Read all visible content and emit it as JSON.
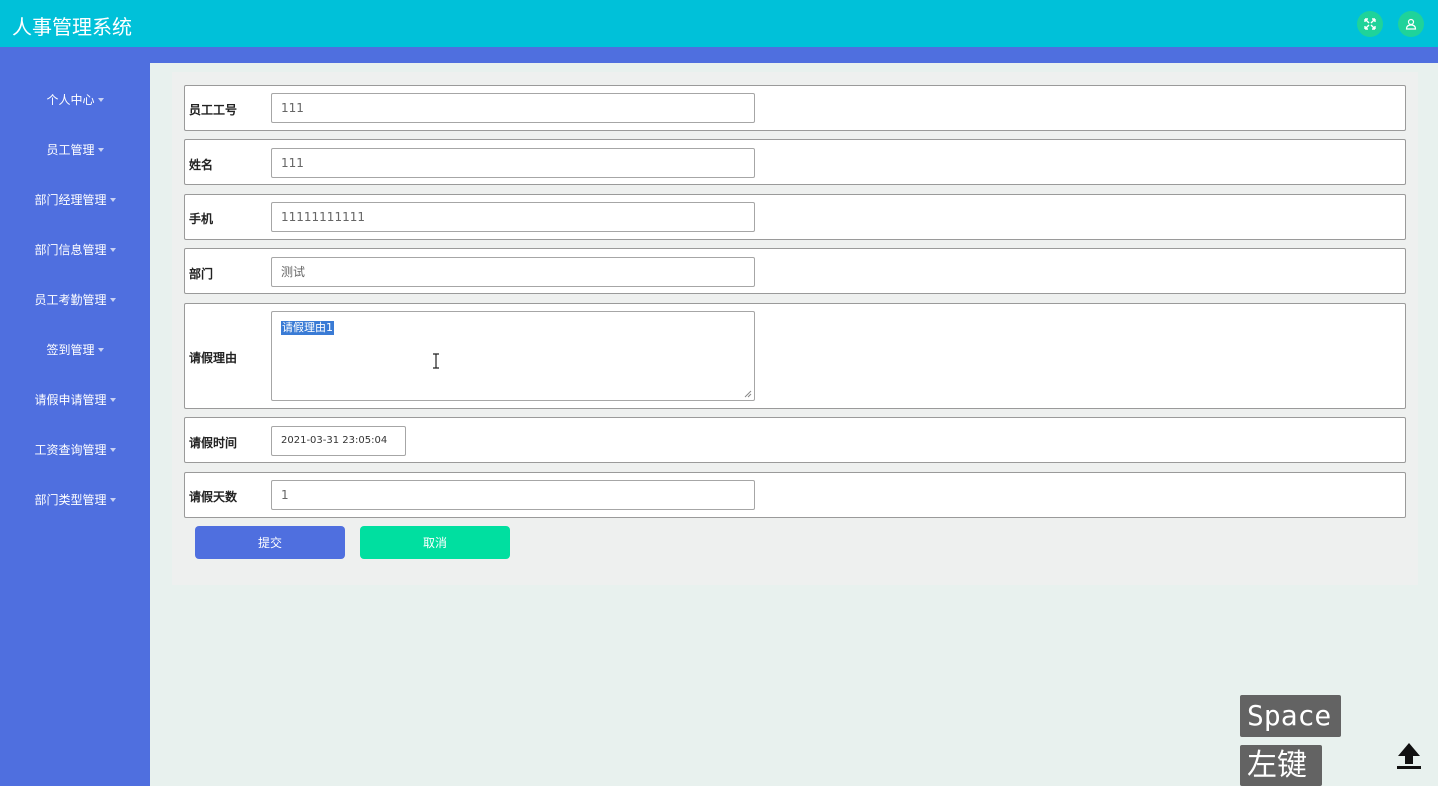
{
  "app": {
    "title": "人事管理系统"
  },
  "header": {
    "fullscreen_icon": "expand-icon",
    "user_icon": "user-icon"
  },
  "sidebar": {
    "items": [
      {
        "label": "个人中心"
      },
      {
        "label": "员工管理"
      },
      {
        "label": "部门经理管理"
      },
      {
        "label": "部门信息管理"
      },
      {
        "label": "员工考勤管理"
      },
      {
        "label": "签到管理"
      },
      {
        "label": "请假申请管理"
      },
      {
        "label": "工资查询管理"
      },
      {
        "label": "部门类型管理"
      }
    ]
  },
  "form": {
    "employee_no": {
      "label": "员工工号",
      "value": "111"
    },
    "name": {
      "label": "姓名",
      "value": "111"
    },
    "phone": {
      "label": "手机",
      "value": "11111111111"
    },
    "department": {
      "label": "部门",
      "value": "测试"
    },
    "leave_reason": {
      "label": "请假理由",
      "value": "请假理由1"
    },
    "leave_time": {
      "label": "请假时间",
      "value": "2021-03-31 23:05:04"
    },
    "leave_days": {
      "label": "请假天数",
      "value": "1"
    }
  },
  "buttons": {
    "submit": "提交",
    "cancel": "取消"
  },
  "overlay": {
    "space_key": "Space",
    "left_click": "左键"
  },
  "colors": {
    "topbar": "#00c1d9",
    "sidebar": "#4f6fdf",
    "submit": "#4f6fdf",
    "cancel": "#00dfa0",
    "header_buttons": "#1fd39a"
  }
}
